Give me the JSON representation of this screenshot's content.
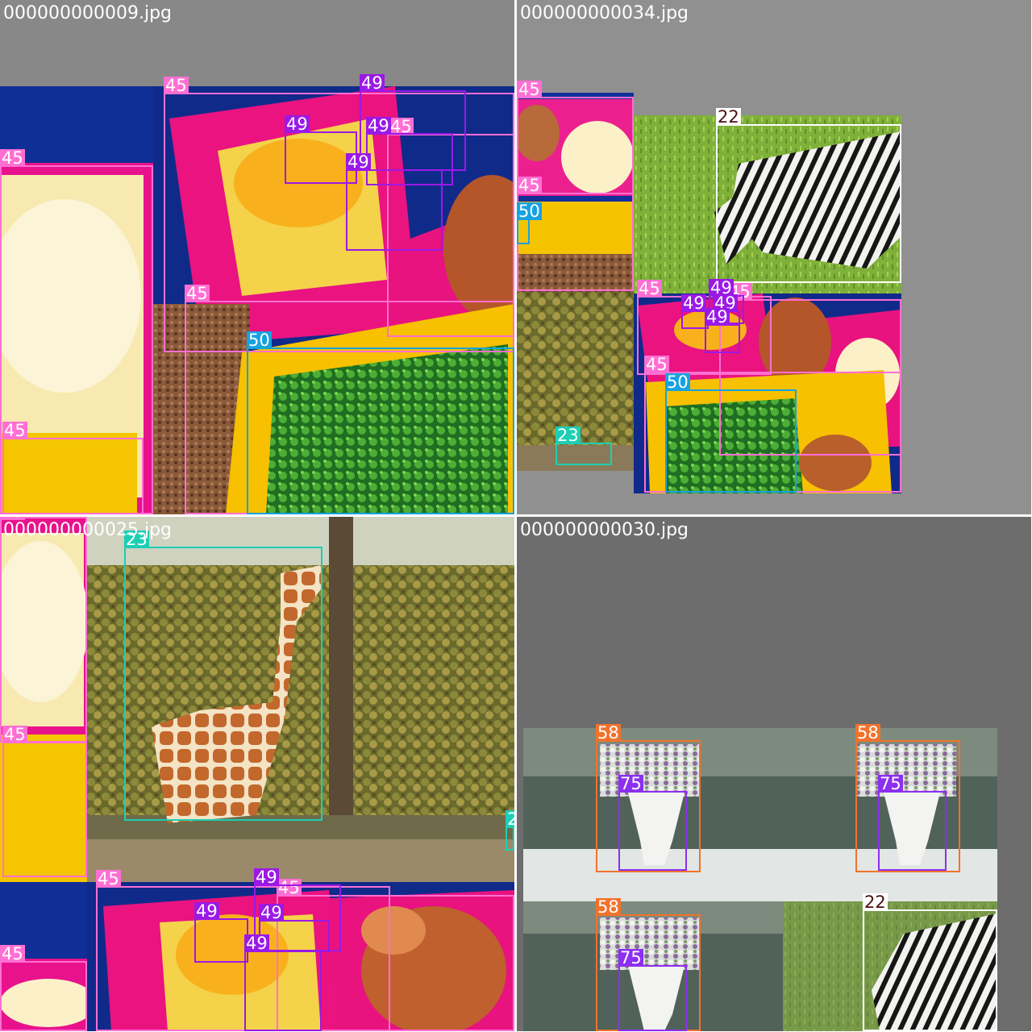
{
  "tiles": [
    {
      "filename": "000000000009.jpg"
    },
    {
      "filename": "000000000034.jpg"
    },
    {
      "filename": "000000000025.jpg"
    },
    {
      "filename": "000000000030.jpg"
    }
  ],
  "class_ids": {
    "zebra": "22",
    "giraffe": "23",
    "bowl": "45",
    "orange": "49",
    "broccoli": "50",
    "potted_plant": "58",
    "vase": "75"
  },
  "class_colors": {
    "22": "#ffffff",
    "23": "#1ccfb4",
    "45": "#ff6fd3",
    "49": "#9b19e6",
    "50": "#17a2e0",
    "58": "#f2722b",
    "75": "#8c2ff0"
  }
}
